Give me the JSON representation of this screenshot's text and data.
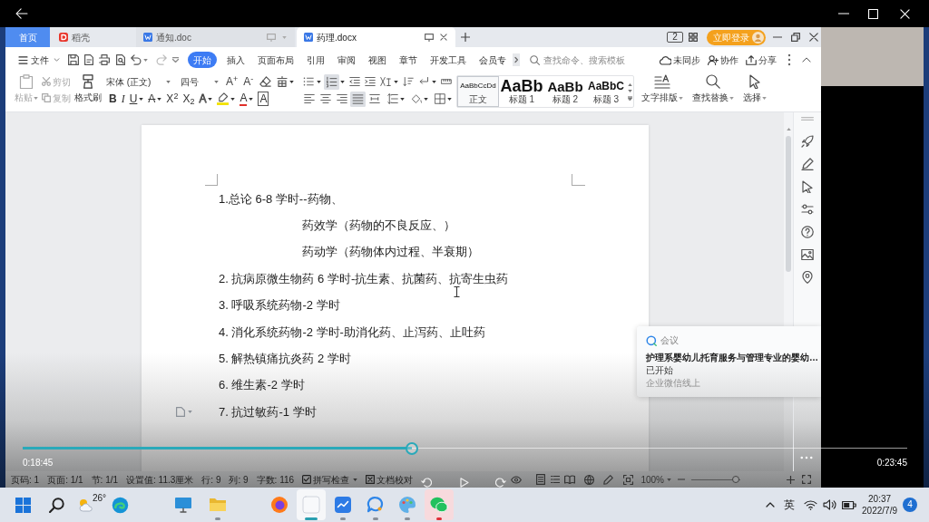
{
  "player": {
    "current_time": "0:18:45",
    "total_time": "0:23:45",
    "progress": {
      "level": 0.44
    }
  },
  "wps": {
    "tabs": [
      {
        "label": "首页",
        "kind": "home",
        "selected": false
      },
      {
        "label": "稻壳",
        "kind": "store",
        "selected": false
      },
      {
        "label": "通知.doc",
        "kind": "doc",
        "selected": false
      },
      {
        "label": "药理.docx",
        "kind": "doc",
        "selected": true
      }
    ],
    "window_count": "2",
    "login_button": "立即登录",
    "file_menu": "文件",
    "ribbon_tabs": [
      {
        "label": "开始",
        "selected": true
      },
      {
        "label": "插入",
        "selected": false
      },
      {
        "label": "页面布局",
        "selected": false
      },
      {
        "label": "引用",
        "selected": false
      },
      {
        "label": "审阅",
        "selected": false
      },
      {
        "label": "视图",
        "selected": false
      },
      {
        "label": "章节",
        "selected": false
      },
      {
        "label": "开发工具",
        "selected": false
      },
      {
        "label": "会员专",
        "selected": false
      }
    ],
    "command_search": {
      "placeholder": "查找命令、搜索模板"
    },
    "actions": [
      {
        "label": "未同步",
        "kind": "sync"
      },
      {
        "label": "协作",
        "kind": "collaborate"
      },
      {
        "label": "分享",
        "kind": "share"
      }
    ],
    "clipboard": [
      {
        "label": "粘贴",
        "kind": "paste",
        "disabled": true
      },
      {
        "label": "剪切",
        "kind": "cut",
        "disabled": true
      },
      {
        "label": "复制",
        "kind": "copy",
        "disabled": true
      },
      {
        "label": "格式刷",
        "kind": "format-painter",
        "disabled": false
      }
    ],
    "font": {
      "family": "宋体 (正文)",
      "size": "四号"
    },
    "font_size_buttons": [
      "A$^{+}$",
      "A$^{-}$"
    ],
    "format_buttons": [
      {
        "glyph": "B",
        "kind": "bold",
        "caret": false
      },
      {
        "glyph": "I",
        "kind": "italic",
        "caret": false
      },
      {
        "glyph": "U",
        "kind": "underline",
        "caret": true
      },
      {
        "glyph": "A",
        "kind": "strikethrough",
        "caret": true
      },
      {
        "glyph": "X$^{2}$",
        "kind": "superscript",
        "caret": false
      },
      {
        "glyph": "X$_{2}$",
        "kind": "subscript",
        "caret": false
      },
      {
        "glyph": "A",
        "kind": "effect",
        "caret": true
      },
      {
        "kind": "highlight",
        "caret": true
      },
      {
        "glyph": "A",
        "kind": "color",
        "caret": true
      },
      {
        "glyph": "A",
        "kind": "border",
        "caret": false
      }
    ],
    "paragraph_tools": [
      {
        "kind": "bullets",
        "on": false,
        "caret": true
      },
      {
        "kind": "numbering",
        "on": true,
        "caret": true
      },
      {
        "kind": "outdent",
        "on": false,
        "caret": false
      },
      {
        "kind": "indent",
        "on": false,
        "caret": false
      },
      {
        "kind": "asian-layout",
        "on": false,
        "caret": true
      },
      {
        "kind": "sort",
        "on": false,
        "caret": false
      },
      {
        "kind": "marks",
        "on": false,
        "caret": true
      },
      {
        "kind": "tabs",
        "on": false,
        "caret": false
      }
    ],
    "alignment": [
      {
        "kind": "left",
        "on": false
      },
      {
        "kind": "center",
        "on": false
      },
      {
        "kind": "right",
        "on": false
      },
      {
        "kind": "justify",
        "on": true
      },
      {
        "kind": "distributed",
        "on": false
      }
    ],
    "styles": [
      {
        "preview": "AaBbCcDd",
        "label": "正文",
        "selected": true
      },
      {
        "preview": "AaBb",
        "label": "标题 1",
        "selected": false
      },
      {
        "preview": "AaBb",
        "label": "标题 2",
        "selected": false
      },
      {
        "preview": "AaBbC",
        "label": "标题 3",
        "selected": false
      }
    ],
    "tools": [
      {
        "label": "文字排版",
        "kind": "text-layout"
      },
      {
        "label": "查找替换",
        "kind": "find-replace"
      },
      {
        "label": "选择",
        "kind": "select"
      }
    ],
    "document": {
      "lines": [
        {
          "text": "1.总论 6-8 学时--药物、",
          "children": [
            {
              "text": "药效学（药物的不良反应、）"
            },
            {
              "text": "药动学（药物体内过程、半衰期）"
            }
          ]
        },
        {
          "text": "2. 抗病原微生物药 6 学时-抗生素、抗菌药、抗寄生虫药"
        },
        {
          "text": "3. 呼吸系统药物-2 学时"
        },
        {
          "text": "4. 消化系统药物-2 学时-助消化药、止泻药、止吐药"
        },
        {
          "text": "5. 解热镇痛抗炎药 2 学时"
        },
        {
          "text": "6. 维生素-2 学时"
        },
        {
          "text": "7. 抗过敏药-1 学时"
        }
      ]
    },
    "status_bar": {
      "fields": [
        "页码: 1",
        "页面: 1/1",
        "节: 1/1",
        "设置值: 11.3厘米",
        "行: 9",
        "列: 9",
        "字数: 116"
      ],
      "spell_check": {
        "label": "拼写检查",
        "checked": true
      },
      "proofread": "文档校对",
      "zoom": "100%",
      "zoom_slider": {
        "level": 0.9
      }
    }
  },
  "notification": {
    "app": "会议",
    "title": "护理系婴幼儿托育服务与管理专业的婴幼…",
    "status": "已开始",
    "source": "企业微信线上"
  },
  "taskbar": {
    "weather": "26°",
    "apps": [
      {
        "kind": "monitor",
        "running": false,
        "selected": false,
        "attention": false
      },
      {
        "kind": "folder",
        "running": true,
        "selected": false,
        "attention": false
      },
      {
        "kind": "browser",
        "running": false,
        "selected": false,
        "attention": false
      },
      {
        "kind": "blank",
        "running": true,
        "selected": true,
        "attention": false
      },
      {
        "kind": "board",
        "running": true,
        "selected": false,
        "attention": false
      },
      {
        "kind": "chat",
        "running": true,
        "selected": false,
        "attention": false
      },
      {
        "kind": "palette",
        "running": true,
        "selected": false,
        "attention": false
      },
      {
        "kind": "messenger",
        "running": true,
        "selected": false,
        "attention": true
      }
    ],
    "ime": "英",
    "time": "20:37",
    "date": "2022/7/9",
    "notification_count": "4"
  }
}
